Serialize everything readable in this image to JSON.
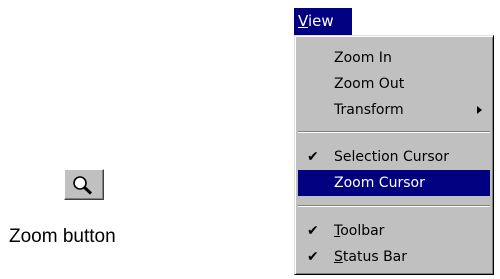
{
  "zoom_button": {
    "icon": "magnifier-icon",
    "caption": "Zoom button"
  },
  "menu": {
    "title_mnemonic": "V",
    "title_rest": "iew",
    "items": [
      {
        "label": "Zoom In"
      },
      {
        "label": "Zoom Out"
      },
      {
        "label": "Transform",
        "submenu": true,
        "icon": "submenu-arrow-icon"
      },
      {
        "label": "Selection Cursor",
        "checked": true,
        "icon": "check-icon"
      },
      {
        "label": "Zoom Cursor",
        "selected": true
      },
      {
        "label_mnemonic": "T",
        "label_rest": "oolbar",
        "checked": true,
        "icon": "check-icon"
      },
      {
        "label_mnemonic": "S",
        "label_rest": "tatus Bar",
        "checked": true,
        "icon": "check-icon"
      }
    ],
    "check_glyph": "✔"
  },
  "colors": {
    "highlight": "#000080",
    "menu_face": "#c0c0c0"
  }
}
